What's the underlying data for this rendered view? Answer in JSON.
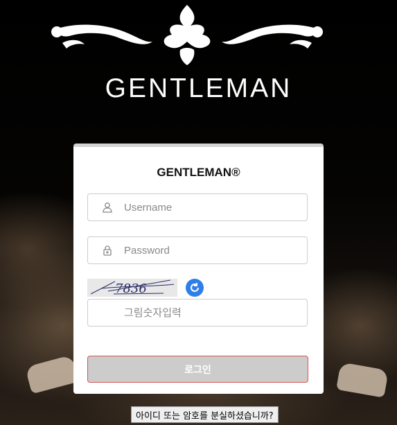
{
  "brand": {
    "logo_text": "GENTLEMAN"
  },
  "login": {
    "title": "GENTLEMAN®",
    "username_placeholder": "Username",
    "password_placeholder": "Password",
    "captcha_code": "7836",
    "captcha_placeholder": "그림숫자입력",
    "submit_label": "로그인",
    "forgot_label": "아이디 또는 암호를 분실하셨습니까?"
  },
  "icons": {
    "username": "user-icon",
    "password": "lock-icon",
    "refresh": "refresh-icon"
  },
  "colors": {
    "accent": "#2f7fe8",
    "login_border": "#d9534f",
    "button_bg": "#cccccc"
  }
}
